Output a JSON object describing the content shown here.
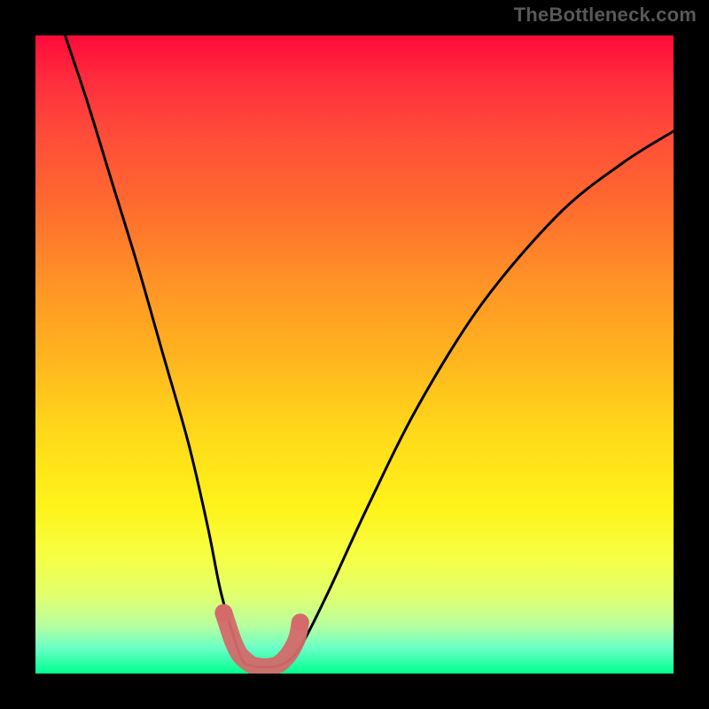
{
  "watermark": "TheBottleneck.com",
  "chart_data": {
    "type": "line",
    "title": "",
    "xlabel": "",
    "ylabel": "",
    "xlim": [
      0,
      100
    ],
    "ylim": [
      0,
      100
    ],
    "series": [
      {
        "name": "bottleneck-curve",
        "x": [
          0,
          4,
          8,
          12,
          16,
          20,
          24,
          27,
          29,
          31,
          32.5,
          34,
          36,
          38,
          40,
          42,
          46,
          52,
          60,
          70,
          82,
          92,
          100
        ],
        "values": [
          115,
          102,
          90,
          77,
          64,
          50,
          36,
          23,
          13,
          6,
          2.0,
          1.2,
          1.0,
          1.2,
          2.3,
          5,
          13,
          26,
          42,
          58,
          72,
          80,
          85
        ]
      }
    ],
    "highlight": {
      "name": "optimal-range",
      "x": [
        29.5,
        31,
        32,
        33,
        34,
        35,
        36,
        37,
        38,
        39,
        40,
        41,
        41.5
      ],
      "values": [
        9.5,
        5,
        3,
        2,
        1.3,
        1.1,
        1.0,
        1.1,
        1.4,
        2.2,
        3.5,
        5.5,
        8.0
      ]
    },
    "gradient_stops": [
      {
        "pos": 0,
        "color": "#ff0a3a"
      },
      {
        "pos": 7,
        "color": "#ff2d3d"
      },
      {
        "pos": 15,
        "color": "#ff4a3a"
      },
      {
        "pos": 27,
        "color": "#ff6c2e"
      },
      {
        "pos": 39,
        "color": "#ff9426"
      },
      {
        "pos": 50,
        "color": "#ffb31f"
      },
      {
        "pos": 62,
        "color": "#ffd81a"
      },
      {
        "pos": 74,
        "color": "#fff31a"
      },
      {
        "pos": 82,
        "color": "#f5ff46"
      },
      {
        "pos": 88,
        "color": "#e0ff70"
      },
      {
        "pos": 92.5,
        "color": "#b6ffa0"
      },
      {
        "pos": 96,
        "color": "#6affc6"
      },
      {
        "pos": 100,
        "color": "#00ff8f"
      }
    ],
    "curve_color": "#000000",
    "highlight_color": "#d46a6a"
  }
}
